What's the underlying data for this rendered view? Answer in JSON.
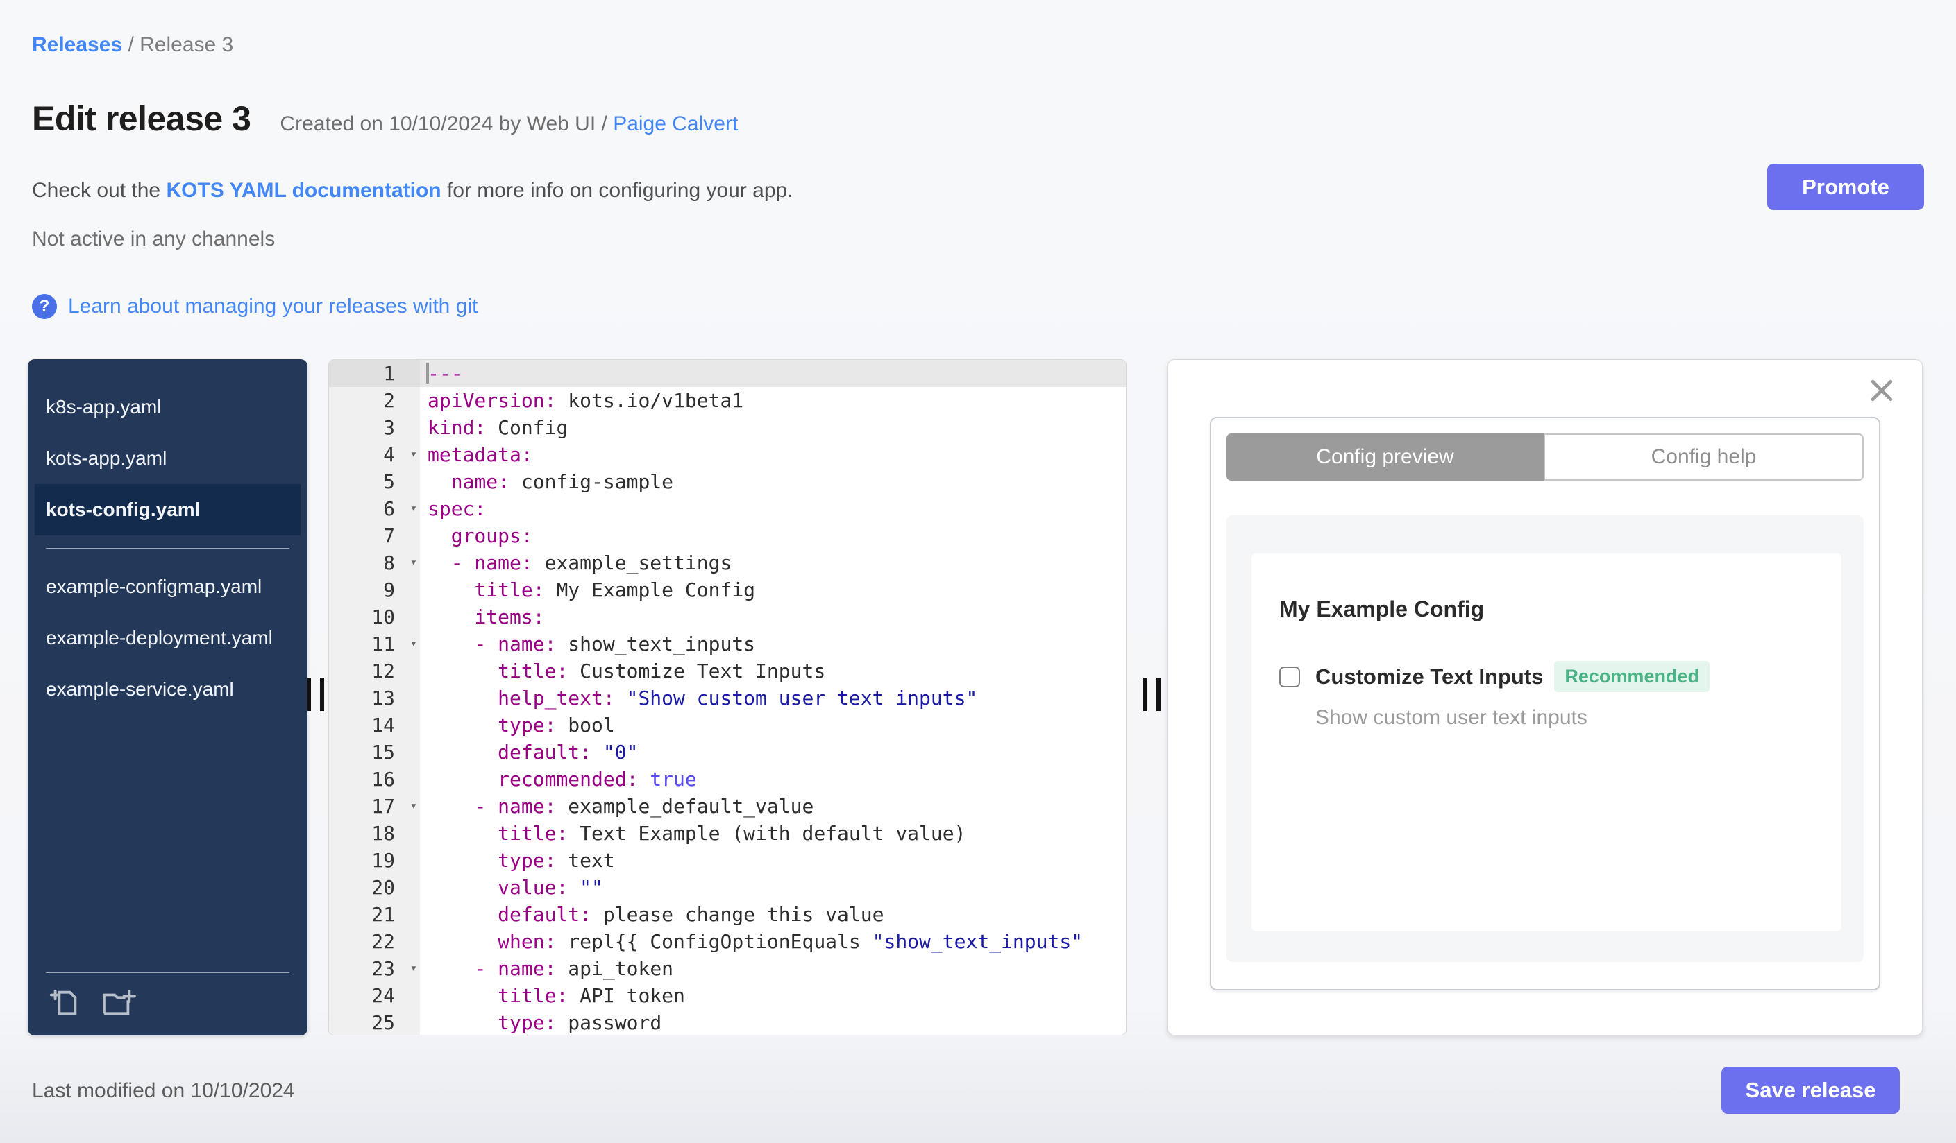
{
  "breadcrumb": {
    "link": "Releases",
    "separator": " / ",
    "current": "Release 3"
  },
  "header": {
    "title": "Edit release 3",
    "created_prefix": "Created on 10/10/2024 by Web UI / ",
    "author": "Paige Calvert",
    "doc_prefix": "Check out the ",
    "doc_link": "KOTS YAML documentation",
    "doc_suffix": " for more info on configuring your app.",
    "channel_status": "Not active in any channels",
    "help_icon": "?",
    "git_link": "Learn about managing your releases with git",
    "promote_label": "Promote"
  },
  "sidebar": {
    "files": [
      {
        "name": "k8s-app.yaml",
        "selected": false
      },
      {
        "name": "kots-app.yaml",
        "selected": false
      },
      {
        "name": "kots-config.yaml",
        "selected": true
      },
      {
        "divider": true
      },
      {
        "name": "example-configmap.yaml",
        "selected": false
      },
      {
        "name": "example-deployment.yaml",
        "selected": false
      },
      {
        "name": "example-service.yaml",
        "selected": false
      }
    ],
    "icons": [
      "add-file-icon",
      "add-folder-icon"
    ]
  },
  "editor": {
    "lines": [
      {
        "n": 1,
        "active": true,
        "cursor": true,
        "tokens": [
          {
            "t": "key",
            "v": "---"
          }
        ]
      },
      {
        "n": 2,
        "tokens": [
          {
            "t": "key",
            "v": "apiVersion:"
          },
          {
            "t": "text",
            "v": " kots.io/v1beta1"
          }
        ]
      },
      {
        "n": 3,
        "tokens": [
          {
            "t": "key",
            "v": "kind:"
          },
          {
            "t": "text",
            "v": " Config"
          }
        ]
      },
      {
        "n": 4,
        "fold": true,
        "tokens": [
          {
            "t": "key",
            "v": "metadata:"
          }
        ]
      },
      {
        "n": 5,
        "tokens": [
          {
            "t": "text",
            "v": "  "
          },
          {
            "t": "key",
            "v": "name:"
          },
          {
            "t": "text",
            "v": " config-sample"
          }
        ]
      },
      {
        "n": 6,
        "fold": true,
        "tokens": [
          {
            "t": "key",
            "v": "spec:"
          }
        ]
      },
      {
        "n": 7,
        "tokens": [
          {
            "t": "text",
            "v": "  "
          },
          {
            "t": "key",
            "v": "groups:"
          }
        ]
      },
      {
        "n": 8,
        "fold": true,
        "tokens": [
          {
            "t": "text",
            "v": "  "
          },
          {
            "t": "key",
            "v": "- name:"
          },
          {
            "t": "text",
            "v": " example_settings"
          }
        ]
      },
      {
        "n": 9,
        "tokens": [
          {
            "t": "text",
            "v": "    "
          },
          {
            "t": "key",
            "v": "title:"
          },
          {
            "t": "text",
            "v": " My Example Config"
          }
        ]
      },
      {
        "n": 10,
        "tokens": [
          {
            "t": "text",
            "v": "    "
          },
          {
            "t": "key",
            "v": "items:"
          }
        ]
      },
      {
        "n": 11,
        "fold": true,
        "tokens": [
          {
            "t": "text",
            "v": "    "
          },
          {
            "t": "key",
            "v": "- name:"
          },
          {
            "t": "text",
            "v": " show_text_inputs"
          }
        ]
      },
      {
        "n": 12,
        "tokens": [
          {
            "t": "text",
            "v": "      "
          },
          {
            "t": "key",
            "v": "title:"
          },
          {
            "t": "text",
            "v": " Customize Text Inputs"
          }
        ]
      },
      {
        "n": 13,
        "tokens": [
          {
            "t": "text",
            "v": "      "
          },
          {
            "t": "key",
            "v": "help_text:"
          },
          {
            "t": "text",
            "v": " "
          },
          {
            "t": "str",
            "v": "\"Show custom user text inputs\""
          }
        ]
      },
      {
        "n": 14,
        "tokens": [
          {
            "t": "text",
            "v": "      "
          },
          {
            "t": "key",
            "v": "type:"
          },
          {
            "t": "text",
            "v": " bool"
          }
        ]
      },
      {
        "n": 15,
        "tokens": [
          {
            "t": "text",
            "v": "      "
          },
          {
            "t": "key",
            "v": "default:"
          },
          {
            "t": "text",
            "v": " "
          },
          {
            "t": "str",
            "v": "\"0\""
          }
        ]
      },
      {
        "n": 16,
        "tokens": [
          {
            "t": "text",
            "v": "      "
          },
          {
            "t": "key",
            "v": "recommended:"
          },
          {
            "t": "text",
            "v": " "
          },
          {
            "t": "const",
            "v": "true"
          }
        ]
      },
      {
        "n": 17,
        "fold": true,
        "tokens": [
          {
            "t": "text",
            "v": "    "
          },
          {
            "t": "key",
            "v": "- name:"
          },
          {
            "t": "text",
            "v": " example_default_value"
          }
        ]
      },
      {
        "n": 18,
        "tokens": [
          {
            "t": "text",
            "v": "      "
          },
          {
            "t": "key",
            "v": "title:"
          },
          {
            "t": "text",
            "v": " Text Example (with default value)"
          }
        ]
      },
      {
        "n": 19,
        "tokens": [
          {
            "t": "text",
            "v": "      "
          },
          {
            "t": "key",
            "v": "type:"
          },
          {
            "t": "text",
            "v": " text"
          }
        ]
      },
      {
        "n": 20,
        "tokens": [
          {
            "t": "text",
            "v": "      "
          },
          {
            "t": "key",
            "v": "value:"
          },
          {
            "t": "text",
            "v": " "
          },
          {
            "t": "str",
            "v": "\"\""
          }
        ]
      },
      {
        "n": 21,
        "tokens": [
          {
            "t": "text",
            "v": "      "
          },
          {
            "t": "key",
            "v": "default:"
          },
          {
            "t": "text",
            "v": " please change this value"
          }
        ]
      },
      {
        "n": 22,
        "tokens": [
          {
            "t": "text",
            "v": "      "
          },
          {
            "t": "key",
            "v": "when:"
          },
          {
            "t": "text",
            "v": " repl{{ ConfigOptionEquals "
          },
          {
            "t": "str",
            "v": "\"show_text_inputs\""
          }
        ]
      },
      {
        "n": 23,
        "fold": true,
        "tokens": [
          {
            "t": "text",
            "v": "    "
          },
          {
            "t": "key",
            "v": "- name:"
          },
          {
            "t": "text",
            "v": " api_token"
          }
        ]
      },
      {
        "n": 24,
        "tokens": [
          {
            "t": "text",
            "v": "      "
          },
          {
            "t": "key",
            "v": "title:"
          },
          {
            "t": "text",
            "v": " API token"
          }
        ]
      },
      {
        "n": 25,
        "tokens": [
          {
            "t": "text",
            "v": "      "
          },
          {
            "t": "key",
            "v": "type:"
          },
          {
            "t": "text",
            "v": " password"
          }
        ]
      }
    ]
  },
  "preview": {
    "tabs": [
      {
        "label": "Config preview",
        "active": true
      },
      {
        "label": "Config help",
        "active": false
      }
    ],
    "group_title": "My Example Config",
    "item_label": "Customize Text Inputs",
    "badge": "Recommended",
    "item_help": "Show custom user text inputs",
    "checkbox_checked": false
  },
  "footer": {
    "last_modified": "Last modified on 10/10/2024",
    "save_label": "Save release"
  },
  "colors": {
    "accent_button": "#6c70ee",
    "link_blue": "#4287f5",
    "sidebar_bg": "#24395a",
    "sidebar_selected_bg": "#132c4e",
    "yaml_key": "#990085",
    "yaml_string": "#1a1aa6",
    "yaml_constant": "#5848f6",
    "badge_bg": "#e3f5ec",
    "badge_text": "#4bb487",
    "tab_active_bg": "#9b9b9b"
  }
}
